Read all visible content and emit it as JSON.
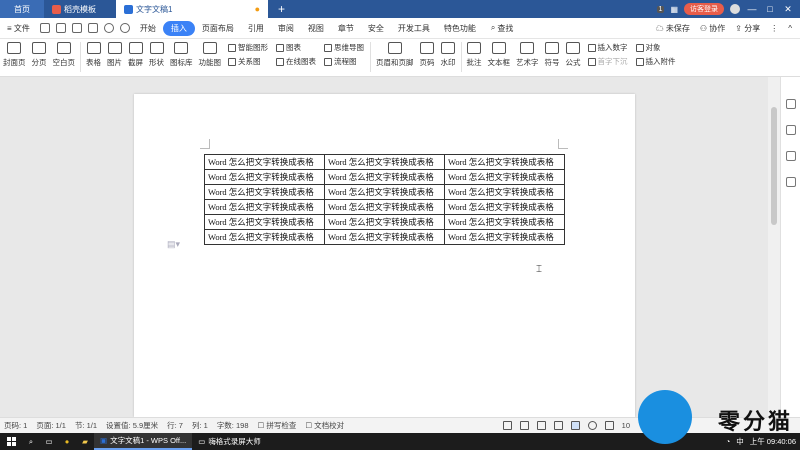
{
  "tabs": {
    "home": "首页",
    "template": "稻壳模板",
    "document": "文字文稿1",
    "new_tab": "+"
  },
  "titlebar": {
    "badge": "1",
    "visitor": "访客登录",
    "minimize": "—",
    "maximize": "□",
    "close": "✕"
  },
  "menu": {
    "file": "≡ 文件",
    "items": [
      "开始",
      "插入",
      "页面布局",
      "引用",
      "审阅",
      "视图",
      "章节",
      "安全",
      "开发工具",
      "特色功能"
    ],
    "search": "查找",
    "unsaved": "未保存",
    "collab": "协作",
    "share": "分享"
  },
  "ribbon": {
    "cover": "封面页",
    "pagebreak": "分页",
    "blankpage": "空白页",
    "table": "表格",
    "picture": "图片",
    "screenshot": "截屏",
    "shape": "形状",
    "iconlib": "图标库",
    "funcimg": "功能图",
    "smartart": "智能图形",
    "chart": "图表",
    "mindmap": "思维导图",
    "relation": "关系图",
    "online_chart": "在线图表",
    "flowchart": "流程图",
    "header_footer": "页眉和页脚",
    "pagenum": "页码",
    "watermark": "水印",
    "comment": "批注",
    "textbox": "文本框",
    "wordart": "艺术字",
    "symbol": "符号",
    "formula": "公式",
    "insert_num": "插入数字",
    "object": "对象",
    "dropcap": "首字下沉",
    "attachment": "插入附件"
  },
  "document": {
    "table_rows": [
      [
        "Word 怎么把文字转换成表格",
        "Word 怎么把文字转换成表格",
        "Word 怎么把文字转换成表格"
      ],
      [
        "Word 怎么把文字转换成表格",
        "Word 怎么把文字转换成表格",
        "Word 怎么把文字转换成表格"
      ],
      [
        "Word 怎么把文字转换成表格",
        "Word 怎么把文字转换成表格",
        "Word 怎么把文字转换成表格"
      ],
      [
        "Word 怎么把文字转换成表格",
        "Word 怎么把文字转换成表格",
        "Word 怎么把文字转换成表格"
      ],
      [
        "Word 怎么把文字转换成表格",
        "Word 怎么把文字转换成表格",
        "Word 怎么把文字转换成表格"
      ],
      [
        "Word 怎么把文字转换成表格",
        "Word 怎么把文字转换成表格",
        "Word 怎么把文字转换成表格"
      ]
    ]
  },
  "status": {
    "page": "页码: 1",
    "pages": "页面: 1/1",
    "section": "节: 1/1",
    "setting": "设置值: 5.9厘米",
    "row": "行: 7",
    "col": "列: 1",
    "words": "字数: 198",
    "spellcheck": "拼写检查",
    "proofread": "文档校对",
    "zoom": "10"
  },
  "taskbar": {
    "app1": "文字文稿1 - WPS Off...",
    "app2": "嗨格式录屏大师",
    "ime": "中",
    "time": "上午 09:40:06"
  },
  "watermark_logo": {
    "text": "零分猫"
  }
}
